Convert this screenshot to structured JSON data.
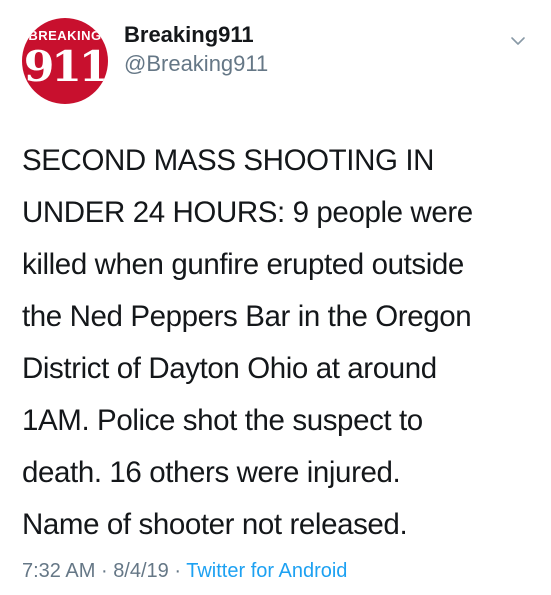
{
  "tweet": {
    "avatar": {
      "top_word": "BREAKING",
      "number": "911"
    },
    "display_name": "Breaking911",
    "handle": "@Breaking911",
    "text": "SECOND MASS SHOOTING IN\nUNDER 24 HOURS: 9 people were\nkilled when gunfire erupted outside\nthe Ned Peppers Bar in the Oregon\nDistrict of Dayton Ohio at around\n1AM. Police shot the suspect to\ndeath. 16 others were injured.\nName of shooter not released.",
    "time": "7:32 AM",
    "separator": "·",
    "date": "8/4/19",
    "source": "Twitter for Android"
  },
  "colors": {
    "brand_red": "#c8102e",
    "link_blue": "#1da1f2",
    "muted_gray": "#657786"
  },
  "icons": {
    "menu": "chevron-down-icon"
  }
}
